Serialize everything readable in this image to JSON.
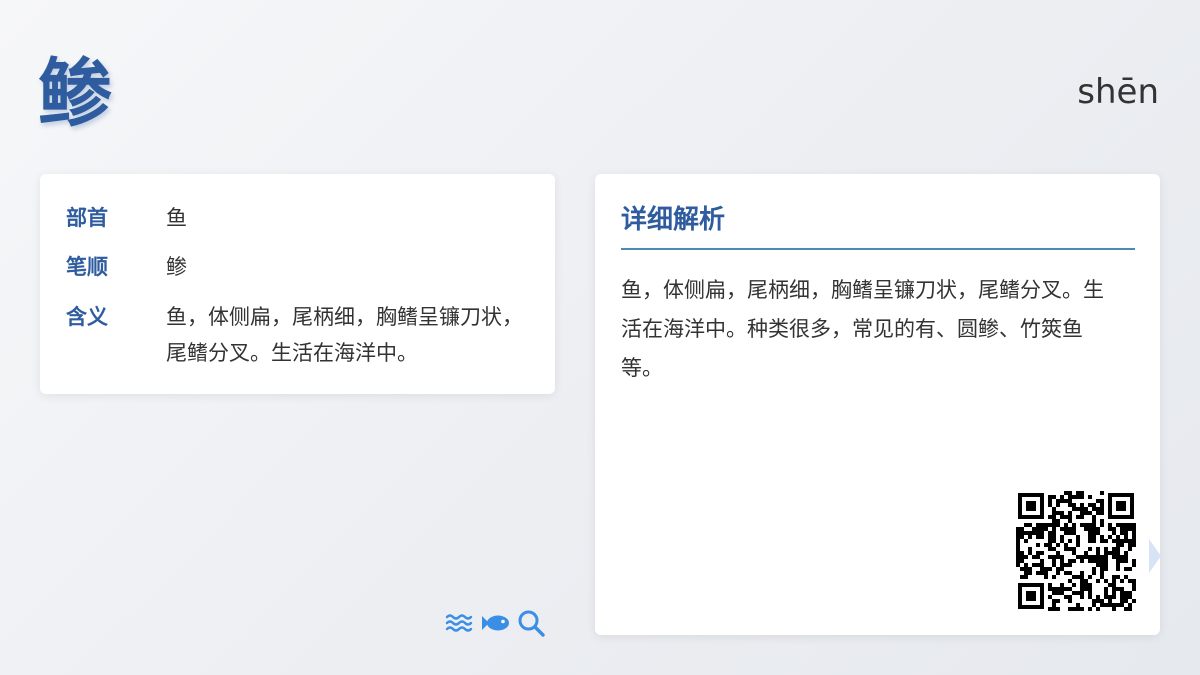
{
  "character": "鲹",
  "pinyin": "shēn",
  "info": {
    "radical_label": "部首",
    "radical_value": "鱼",
    "stroke_label": "笔顺",
    "stroke_value": "鲹",
    "meaning_label": "含义",
    "meaning_value": "鱼，体侧扁，尾柄细，胸鳍呈镰刀状，尾鳍分叉。生活在海洋中。"
  },
  "detail": {
    "title": "详细解析",
    "text": "鱼，体侧扁，尾柄细，胸鳍呈镰刀状，尾鳍分叉。生活在海洋中。种类很多，常见的有、圆鲹、竹筴鱼等。"
  },
  "icons": [
    "waves-icon",
    "fish-icon",
    "search-icon"
  ],
  "colors": {
    "accent": "#2e5c9e",
    "icon": "#3a8ee6",
    "divider": "#4a8ab5",
    "background": "#eef0f3"
  }
}
